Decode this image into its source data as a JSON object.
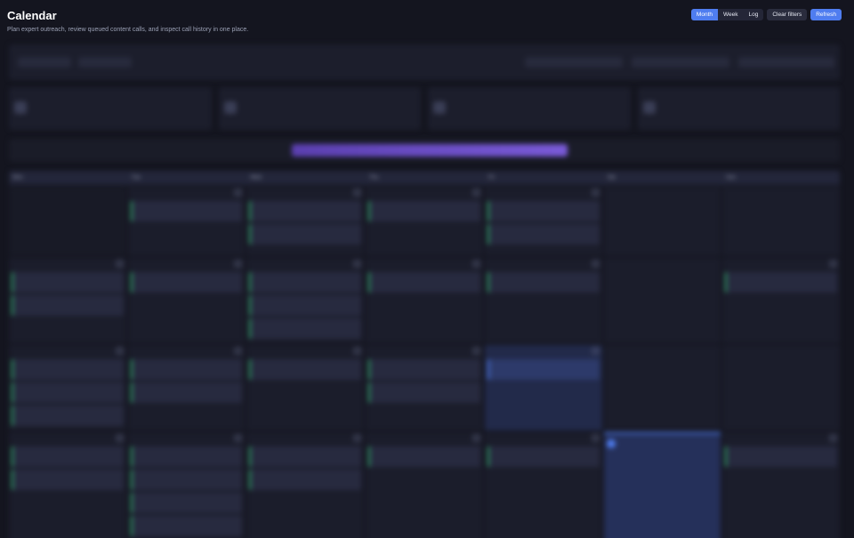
{
  "app": {
    "title": "Calendar",
    "subtitle": "Plan expert outreach, review queued content calls, and inspect call history in one place."
  },
  "toolbar": {
    "views": [
      {
        "label": "Month",
        "active": true
      },
      {
        "label": "Week",
        "active": false
      },
      {
        "label": "Log",
        "active": false
      }
    ],
    "clear_label": "Clear filters",
    "refresh_label": "Refresh"
  },
  "filters": {
    "fields": [
      {
        "label": "",
        "value": ""
      },
      {
        "label": "",
        "value": ""
      },
      {
        "label": "",
        "value": ""
      },
      {
        "label": "",
        "value": ""
      },
      {
        "label": "",
        "value": ""
      }
    ]
  },
  "stats": [
    {
      "value": "",
      "label": ""
    },
    {
      "value": "",
      "label": ""
    },
    {
      "value": "",
      "label": ""
    },
    {
      "value": "",
      "label": ""
    }
  ],
  "progress": {
    "label": "",
    "right_label": "",
    "fraction": 1.0
  },
  "calendar": {
    "weekdays": [
      "Mon",
      "Tue",
      "Wed",
      "Thu",
      "Fri",
      "Sat",
      "Sun"
    ],
    "weeks": [
      [
        {
          "num": "",
          "muted": true,
          "events": []
        },
        {
          "num": "",
          "events": [
            {
              "time": "",
              "title": "",
              "sub": "",
              "link": ""
            }
          ]
        },
        {
          "num": "",
          "events": [
            {
              "time": "",
              "title": "",
              "sub": "",
              "link": ""
            },
            {
              "time": "",
              "title": "",
              "sub": "",
              "link": ""
            }
          ]
        },
        {
          "num": "",
          "events": [
            {
              "time": "",
              "title": "",
              "sub": "",
              "link": ""
            }
          ]
        },
        {
          "num": "",
          "events": [
            {
              "time": "",
              "title": "",
              "sub": "",
              "link": ""
            },
            {
              "time": "",
              "title": "",
              "sub": "",
              "link": ""
            }
          ]
        },
        {
          "num": "",
          "events": []
        },
        {
          "num": "",
          "events": []
        }
      ],
      [
        {
          "num": "",
          "events": [
            {
              "time": "",
              "title": "",
              "sub": "",
              "link": ""
            },
            {
              "time": "",
              "title": "",
              "sub": "",
              "link": ""
            }
          ]
        },
        {
          "num": "",
          "events": [
            {
              "time": "",
              "title": "",
              "sub": "",
              "link": ""
            }
          ]
        },
        {
          "num": "",
          "events": [
            {
              "time": "",
              "title": "",
              "sub": "",
              "link": ""
            },
            {
              "time": "",
              "title": "",
              "sub": "",
              "link": ""
            },
            {
              "time": "",
              "title": "",
              "sub": "",
              "link": ""
            }
          ]
        },
        {
          "num": "",
          "events": [
            {
              "time": "",
              "title": "",
              "sub": "",
              "link": ""
            }
          ]
        },
        {
          "num": "",
          "events": [
            {
              "time": "",
              "title": "",
              "sub": "",
              "link": ""
            }
          ]
        },
        {
          "num": "",
          "events": []
        },
        {
          "num": "",
          "events": [
            {
              "time": "",
              "title": "",
              "sub": "",
              "link": ""
            }
          ]
        }
      ],
      [
        {
          "num": "",
          "events": [
            {
              "time": "",
              "title": "",
              "sub": "",
              "link": ""
            },
            {
              "time": "",
              "title": "",
              "sub": "",
              "link": ""
            },
            {
              "time": "",
              "title": "",
              "sub": "",
              "link": ""
            }
          ]
        },
        {
          "num": "",
          "events": [
            {
              "time": "",
              "title": "",
              "sub": "",
              "link": ""
            },
            {
              "time": "",
              "title": "",
              "sub": "",
              "link": ""
            }
          ]
        },
        {
          "num": "",
          "events": [
            {
              "time": "",
              "title": "",
              "sub": "",
              "link": ""
            }
          ]
        },
        {
          "num": "",
          "events": [
            {
              "time": "",
              "title": "",
              "sub": "",
              "link": ""
            },
            {
              "time": "",
              "title": "",
              "sub": "",
              "link": ""
            }
          ]
        },
        {
          "num": "",
          "today": true,
          "events": [
            {
              "time": "",
              "title": "",
              "sub": "",
              "link": "",
              "sel": true
            }
          ]
        },
        {
          "num": "",
          "events": []
        },
        {
          "num": "",
          "events": []
        }
      ],
      [
        {
          "num": "",
          "events": [
            {
              "time": "",
              "title": "",
              "sub": "",
              "link": ""
            },
            {
              "time": "",
              "title": "",
              "sub": "",
              "link": ""
            }
          ]
        },
        {
          "num": "",
          "events": [
            {
              "time": "",
              "title": "",
              "sub": "",
              "link": ""
            },
            {
              "time": "",
              "title": "",
              "sub": "",
              "link": ""
            },
            {
              "time": "",
              "title": "",
              "sub": "",
              "link": ""
            },
            {
              "time": "",
              "title": "",
              "sub": "",
              "link": ""
            }
          ]
        },
        {
          "num": "",
          "events": [
            {
              "time": "",
              "title": "",
              "sub": "",
              "link": ""
            },
            {
              "time": "",
              "title": "",
              "sub": "",
              "link": ""
            }
          ]
        },
        {
          "num": "",
          "events": [
            {
              "time": "",
              "title": "",
              "sub": "",
              "link": ""
            }
          ]
        },
        {
          "num": "",
          "events": [
            {
              "time": "",
              "title": "",
              "sub": "",
              "link": ""
            }
          ]
        },
        {
          "num": "",
          "selected": true,
          "events": []
        },
        {
          "num": "",
          "events": [
            {
              "time": "",
              "title": "",
              "sub": "",
              "link": ""
            }
          ]
        }
      ]
    ]
  },
  "colors": {
    "accent": "#4f7df0",
    "event_bar": "#2fb06b",
    "background": "#14151f",
    "panel": "#1c1e2c"
  }
}
